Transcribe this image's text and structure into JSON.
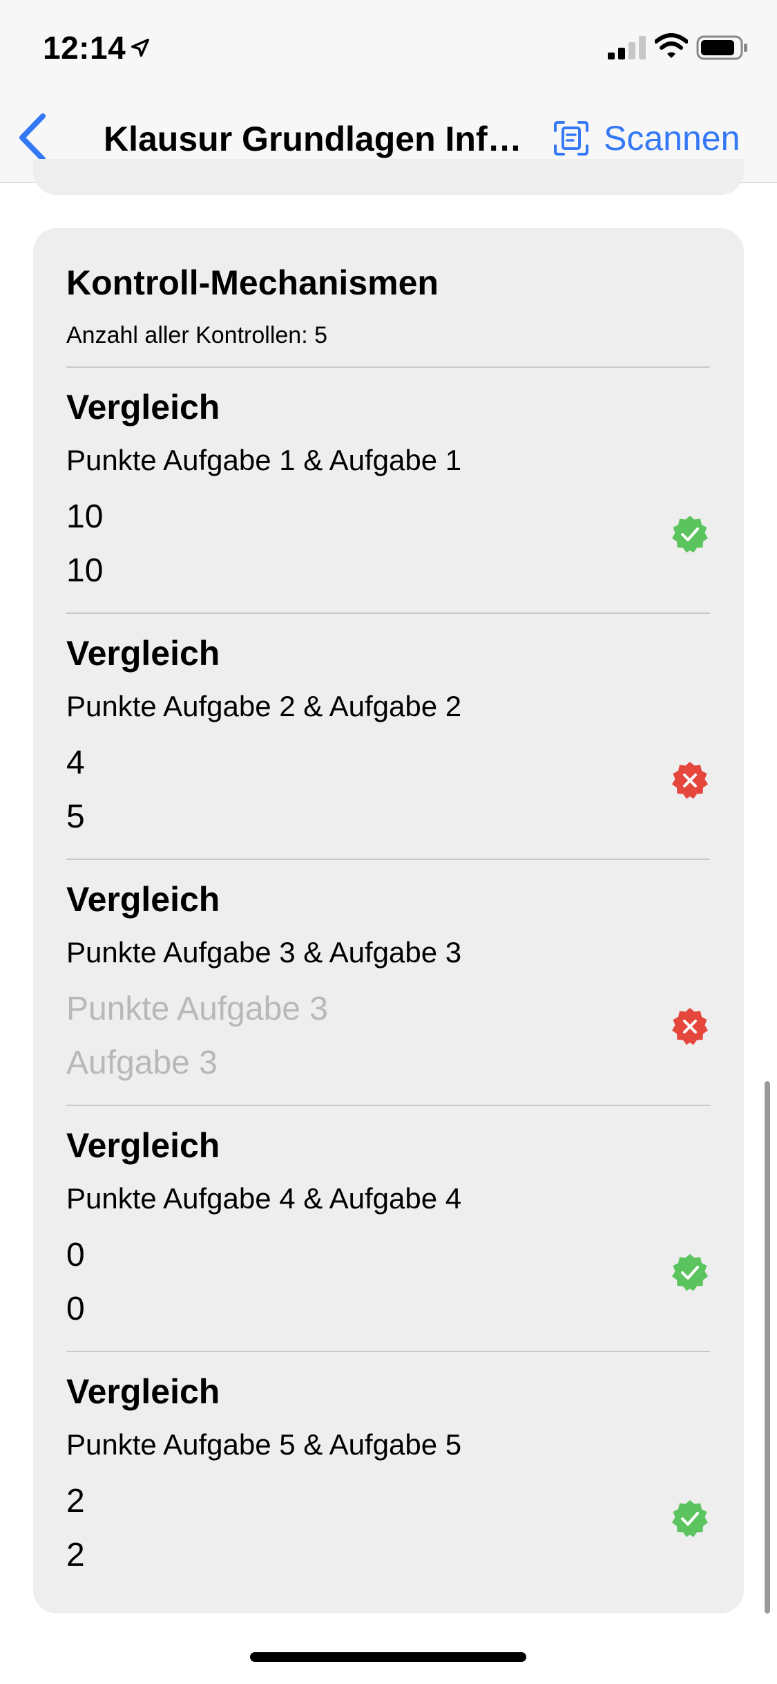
{
  "status_bar": {
    "time": "12:14"
  },
  "nav": {
    "title": "Klausur Grundlagen Info…",
    "scan_label": "Scannen"
  },
  "card": {
    "title": "Kontroll-Mechanismen",
    "subtitle": "Anzahl aller Kontrollen: 5",
    "items": [
      {
        "title": "Vergleich",
        "desc": "Punkte Aufgabe 1 & Aufgabe 1",
        "value1": "10",
        "value2": "10",
        "status": "ok",
        "placeholder": false
      },
      {
        "title": "Vergleich",
        "desc": "Punkte Aufgabe 2 & Aufgabe 2",
        "value1": "4",
        "value2": "5",
        "status": "fail",
        "placeholder": false
      },
      {
        "title": "Vergleich",
        "desc": "Punkte Aufgabe 3 & Aufgabe 3",
        "value1": "Punkte Aufgabe 3",
        "value2": "Aufgabe 3",
        "status": "fail",
        "placeholder": true
      },
      {
        "title": "Vergleich",
        "desc": "Punkte Aufgabe 4 & Aufgabe 4",
        "value1": "0",
        "value2": "0",
        "status": "ok",
        "placeholder": false
      },
      {
        "title": "Vergleich",
        "desc": "Punkte Aufgabe 5 & Aufgabe 5",
        "value1": "2",
        "value2": "2",
        "status": "ok",
        "placeholder": false
      }
    ]
  },
  "colors": {
    "accent": "#3478f6",
    "ok": "#5cc45e",
    "fail": "#e5473d",
    "card_bg": "#eeeeee",
    "placeholder_text": "#b8b8b8"
  },
  "icons": {
    "back": "chevron-left-icon",
    "scan": "document-scan-icon",
    "ok": "checkmark-seal-icon",
    "fail": "xmark-seal-icon"
  }
}
